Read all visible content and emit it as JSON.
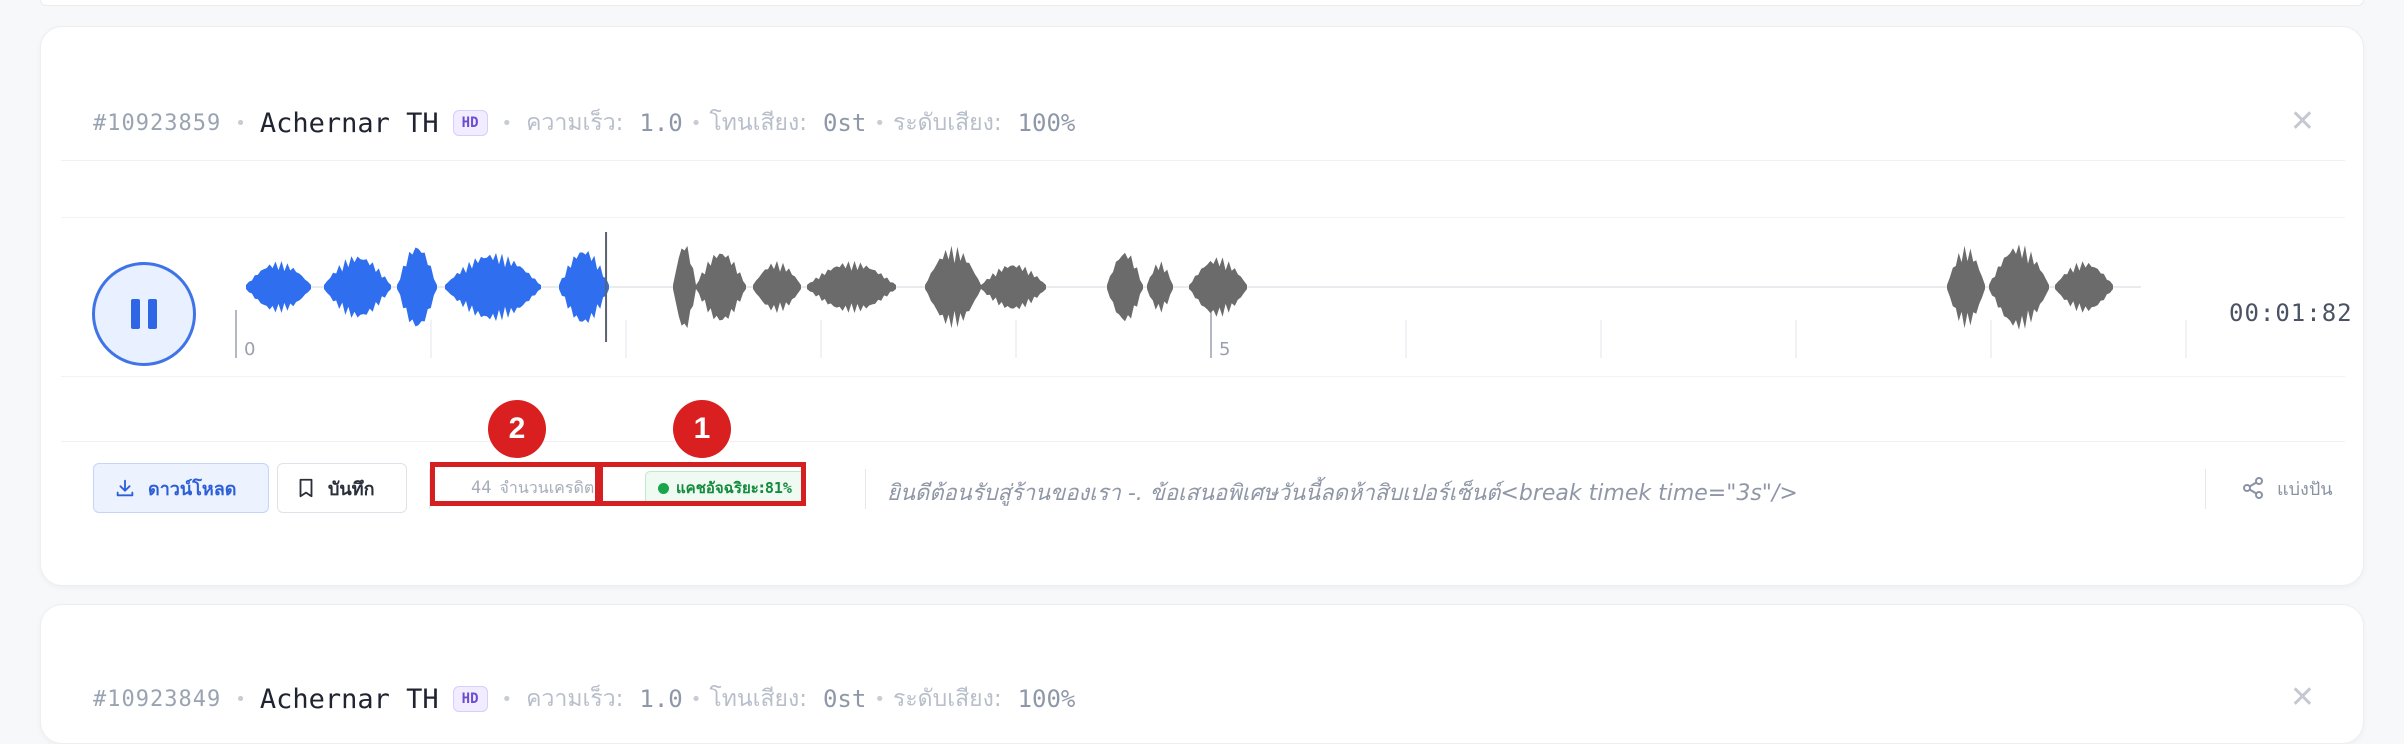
{
  "cards": [
    {
      "job_id": "#10923859",
      "voice": "Achernar TH",
      "quality_badge": "HD",
      "speed_label": "ความเร็ว:",
      "speed_value": "1.0",
      "pitch_label": "โทนเสียง:",
      "pitch_value": "0st",
      "volume_label": "ระดับเสียง:",
      "volume_value": "100%"
    },
    {
      "job_id": "#10923849",
      "voice": "Achernar TH",
      "quality_badge": "HD",
      "speed_label": "ความเร็ว:",
      "speed_value": "1.0",
      "pitch_label": "โทนเสียง:",
      "pitch_value": "0st",
      "volume_label": "ระดับเสียง:",
      "volume_value": "100%"
    }
  ],
  "player": {
    "state": "playing",
    "duration_display": "00:01:82",
    "played_fraction": 0.19,
    "ruler_labels": [
      "0",
      "5"
    ],
    "colors": {
      "played": "#2f6fef",
      "unplayed": "#6b6b6b",
      "playhead": "#5b6270"
    }
  },
  "actions": {
    "download_label": "ดาวน์โหลด",
    "save_label": "บันทึก",
    "credits_value": "44",
    "credits_label": "จำนวนเครดิต",
    "cache_label": "แคชอัจฉริยะ:",
    "cache_value": "81%",
    "script_text": "ยินดีต้อนรับสู่ร้านของเรา -. ข้อเสนอพิเศษวันนี้ลดห้าสิบเปอร์เซ็นต์<break timek time=\"3s\"/>",
    "share_label": "แบ่งปัน"
  },
  "annotations": [
    {
      "number": "1",
      "target": "cache-badge"
    },
    {
      "number": "2",
      "target": "credits-count"
    }
  ],
  "icons": {
    "download": "download-icon",
    "save": "bookmark-icon",
    "share": "share-icon",
    "close": "close-icon",
    "pause": "pause-icon"
  }
}
